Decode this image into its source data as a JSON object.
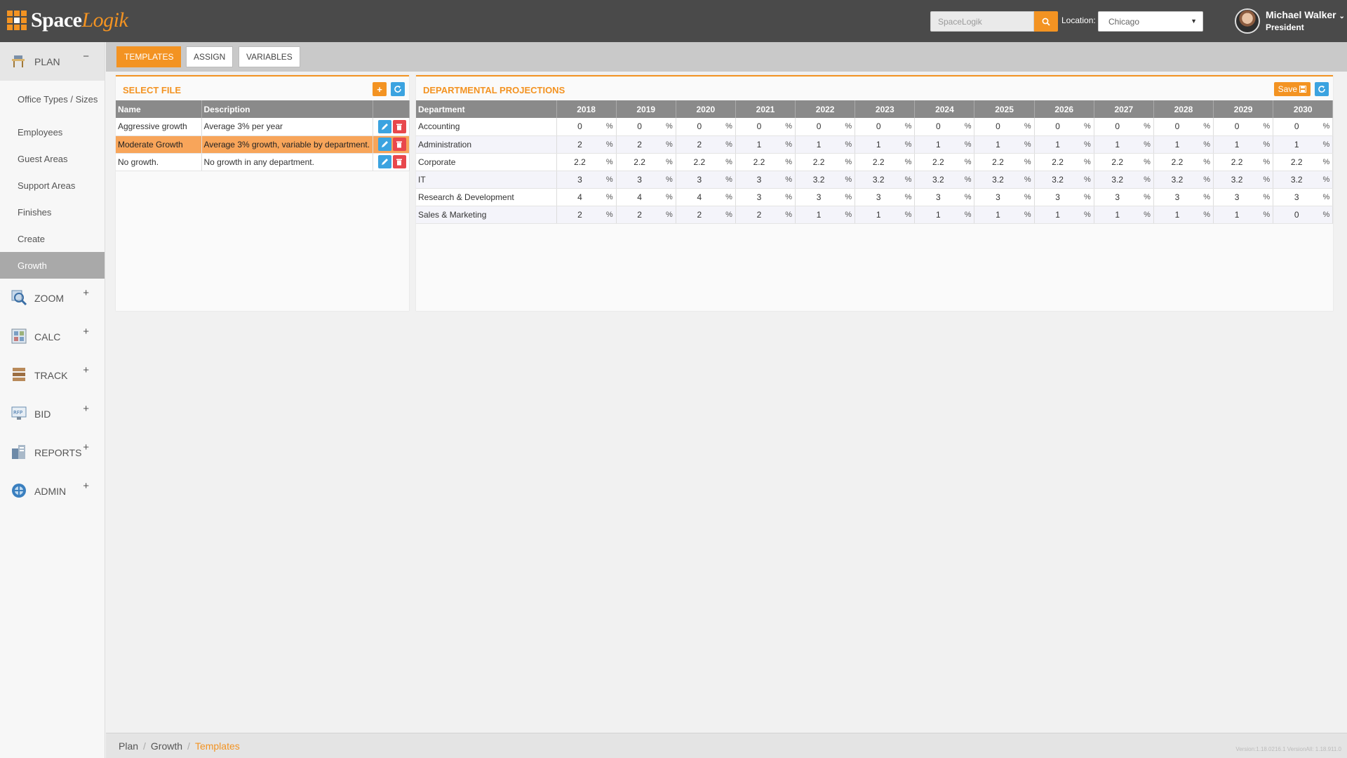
{
  "header": {
    "logo_main": "Space",
    "logo_accent": "Logik",
    "search_placeholder": "SpaceLogik",
    "location_label": "Location:",
    "location_value": "Chicago",
    "user_name": "Michael Walker",
    "user_role": "President"
  },
  "sidebar": {
    "sections": [
      {
        "label": "PLAN",
        "toggle": "−"
      },
      {
        "label": "ZOOM",
        "toggle": "+"
      },
      {
        "label": "CALC",
        "toggle": "+"
      },
      {
        "label": "TRACK",
        "toggle": "+"
      },
      {
        "label": "BID",
        "toggle": "+"
      },
      {
        "label": "REPORTS",
        "toggle": "+"
      },
      {
        "label": "ADMIN",
        "toggle": "+"
      }
    ],
    "plan_items": [
      "Office Types / Sizes",
      "Employees",
      "Guest Areas",
      "Support Areas",
      "Finishes",
      "Create",
      "Growth"
    ]
  },
  "tabs": {
    "templates": "TEMPLATES",
    "assign": "ASSIGN",
    "variables": "VARIABLES"
  },
  "select_file": {
    "title": "SELECT FILE",
    "col_name": "Name",
    "col_desc": "Description",
    "rows": [
      {
        "name": "Aggressive growth",
        "desc": "Average 3% per year"
      },
      {
        "name": "Moderate Growth",
        "desc": "Average 3% growth, variable by department."
      },
      {
        "name": "No growth.",
        "desc": "No growth in any department."
      }
    ]
  },
  "projections": {
    "title": "DEPARTMENTAL PROJECTIONS",
    "save_label": "Save",
    "col_dept": "Department",
    "pct": "%",
    "years": [
      "2018",
      "2019",
      "2020",
      "2021",
      "2022",
      "2023",
      "2024",
      "2025",
      "2026",
      "2027",
      "2028",
      "2029",
      "2030"
    ],
    "rows": [
      {
        "dept": "Accounting",
        "values": [
          "0",
          "0",
          "0",
          "0",
          "0",
          "0",
          "0",
          "0",
          "0",
          "0",
          "0",
          "0",
          "0"
        ]
      },
      {
        "dept": "Administration",
        "values": [
          "2",
          "2",
          "2",
          "1",
          "1",
          "1",
          "1",
          "1",
          "1",
          "1",
          "1",
          "1",
          "1"
        ]
      },
      {
        "dept": "Corporate",
        "values": [
          "2.2",
          "2.2",
          "2.2",
          "2.2",
          "2.2",
          "2.2",
          "2.2",
          "2.2",
          "2.2",
          "2.2",
          "2.2",
          "2.2",
          "2.2"
        ]
      },
      {
        "dept": "IT",
        "values": [
          "3",
          "3",
          "3",
          "3",
          "3.2",
          "3.2",
          "3.2",
          "3.2",
          "3.2",
          "3.2",
          "3.2",
          "3.2",
          "3.2"
        ]
      },
      {
        "dept": "Research & Development",
        "values": [
          "4",
          "4",
          "4",
          "3",
          "3",
          "3",
          "3",
          "3",
          "3",
          "3",
          "3",
          "3",
          "3"
        ]
      },
      {
        "dept": "Sales & Marketing",
        "values": [
          "2",
          "2",
          "2",
          "2",
          "1",
          "1",
          "1",
          "1",
          "1",
          "1",
          "1",
          "1",
          "0"
        ]
      }
    ]
  },
  "breadcrumb": [
    "Plan",
    "Growth",
    "Templates"
  ],
  "version": "Version:1.18.0216.1 VersionAll: 1.18.911.0"
}
